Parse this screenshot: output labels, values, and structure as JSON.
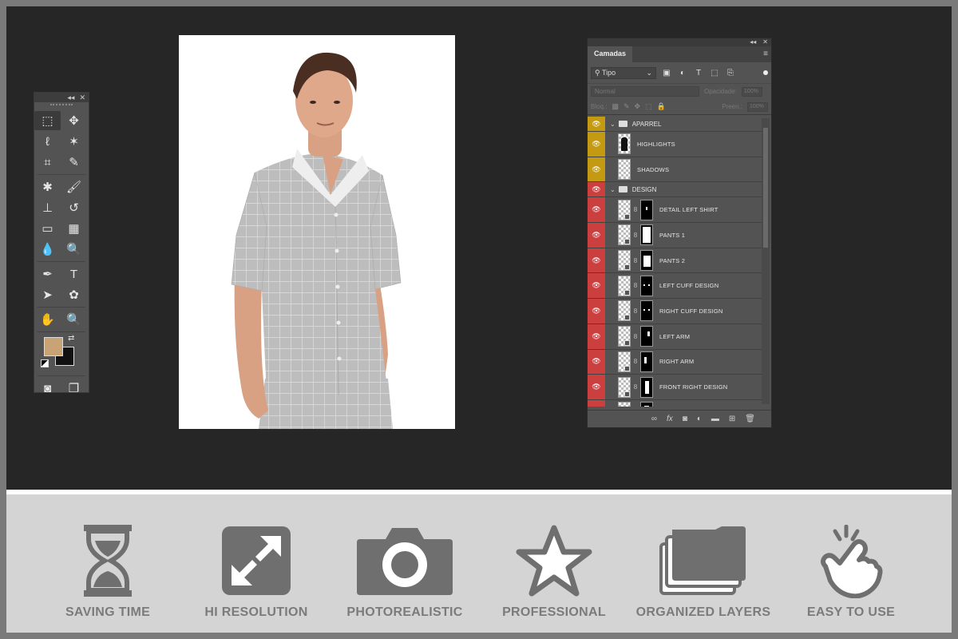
{
  "toolbox": {
    "collapse_glyph": "◂◂",
    "close_glyph": "✕",
    "foreground_color": "#c9a276",
    "background_color": "#111111",
    "tools": [
      {
        "name": "rectangular-marquee-icon",
        "glyph": "⬚"
      },
      {
        "name": "move-icon",
        "glyph": "✥"
      },
      {
        "name": "lasso-icon",
        "glyph": "ℓ"
      },
      {
        "name": "magic-wand-icon",
        "glyph": "✶"
      },
      {
        "name": "crop-icon",
        "glyph": "⌗"
      },
      {
        "name": "eyedropper-icon",
        "glyph": "✎"
      },
      {
        "name": "healing-brush-icon",
        "glyph": "✱"
      },
      {
        "name": "brush-icon",
        "glyph": "🖌"
      },
      {
        "name": "clone-stamp-icon",
        "glyph": "⊥"
      },
      {
        "name": "history-brush-icon",
        "glyph": "↺"
      },
      {
        "name": "eraser-icon",
        "glyph": "▭"
      },
      {
        "name": "gradient-icon",
        "glyph": "▦"
      },
      {
        "name": "blur-icon",
        "glyph": "💧"
      },
      {
        "name": "dodge-icon",
        "glyph": "🔍"
      },
      {
        "name": "pen-icon",
        "glyph": "✒"
      },
      {
        "name": "type-icon",
        "glyph": "T"
      },
      {
        "name": "path-selection-icon",
        "glyph": "➤"
      },
      {
        "name": "shape-icon",
        "glyph": "✿"
      },
      {
        "name": "hand-icon",
        "glyph": "✋"
      },
      {
        "name": "zoom-icon",
        "glyph": "🔍"
      }
    ]
  },
  "layers_panel": {
    "tab_label": "Camadas",
    "filter_kind": "Tipo",
    "blend_mode": "Normal",
    "opacity_label": "Opacidade:",
    "opacity_value": "100%",
    "lock_label": "Bloq.:",
    "fill_label": "Preen.:",
    "fill_value": "100%",
    "colors": {
      "yellow": "#c49a12",
      "red": "#cc3f3f"
    },
    "groups": [
      {
        "name": "APARREL",
        "color": "yellow",
        "layers": [
          {
            "name": "HIGHLIGHTS",
            "type": "figure"
          },
          {
            "name": "SHADOWS",
            "type": "plain"
          }
        ]
      },
      {
        "name": "DESIGN",
        "color": "red",
        "layers": [
          {
            "name": "DETAIL LEFT SHIRT",
            "type": "masked"
          },
          {
            "name": "PANTS 1",
            "type": "masked"
          },
          {
            "name": "PANTS 2",
            "type": "masked"
          },
          {
            "name": "LEFT CUFF DESIGN",
            "type": "masked"
          },
          {
            "name": "RIGHT CUFF DESIGN",
            "type": "masked"
          },
          {
            "name": "LEFT ARM",
            "type": "masked"
          },
          {
            "name": "RIGHT ARM",
            "type": "masked"
          },
          {
            "name": "FRONT RIGHT DESIGN",
            "type": "masked"
          },
          {
            "name": "",
            "type": "masked"
          }
        ]
      }
    ]
  },
  "features": [
    {
      "label": "SAVING TIME",
      "icon": "hourglass-icon"
    },
    {
      "label": "HI RESOLUTION",
      "icon": "expand-arrows-icon"
    },
    {
      "label": "PHOTOREALISTIC",
      "icon": "camera-icon"
    },
    {
      "label": "PROFESSIONAL",
      "icon": "star-icon"
    },
    {
      "label": "ORGANIZED LAYERS",
      "icon": "layers-icon"
    },
    {
      "label": "EASY TO USE",
      "icon": "tap-hand-icon"
    }
  ]
}
